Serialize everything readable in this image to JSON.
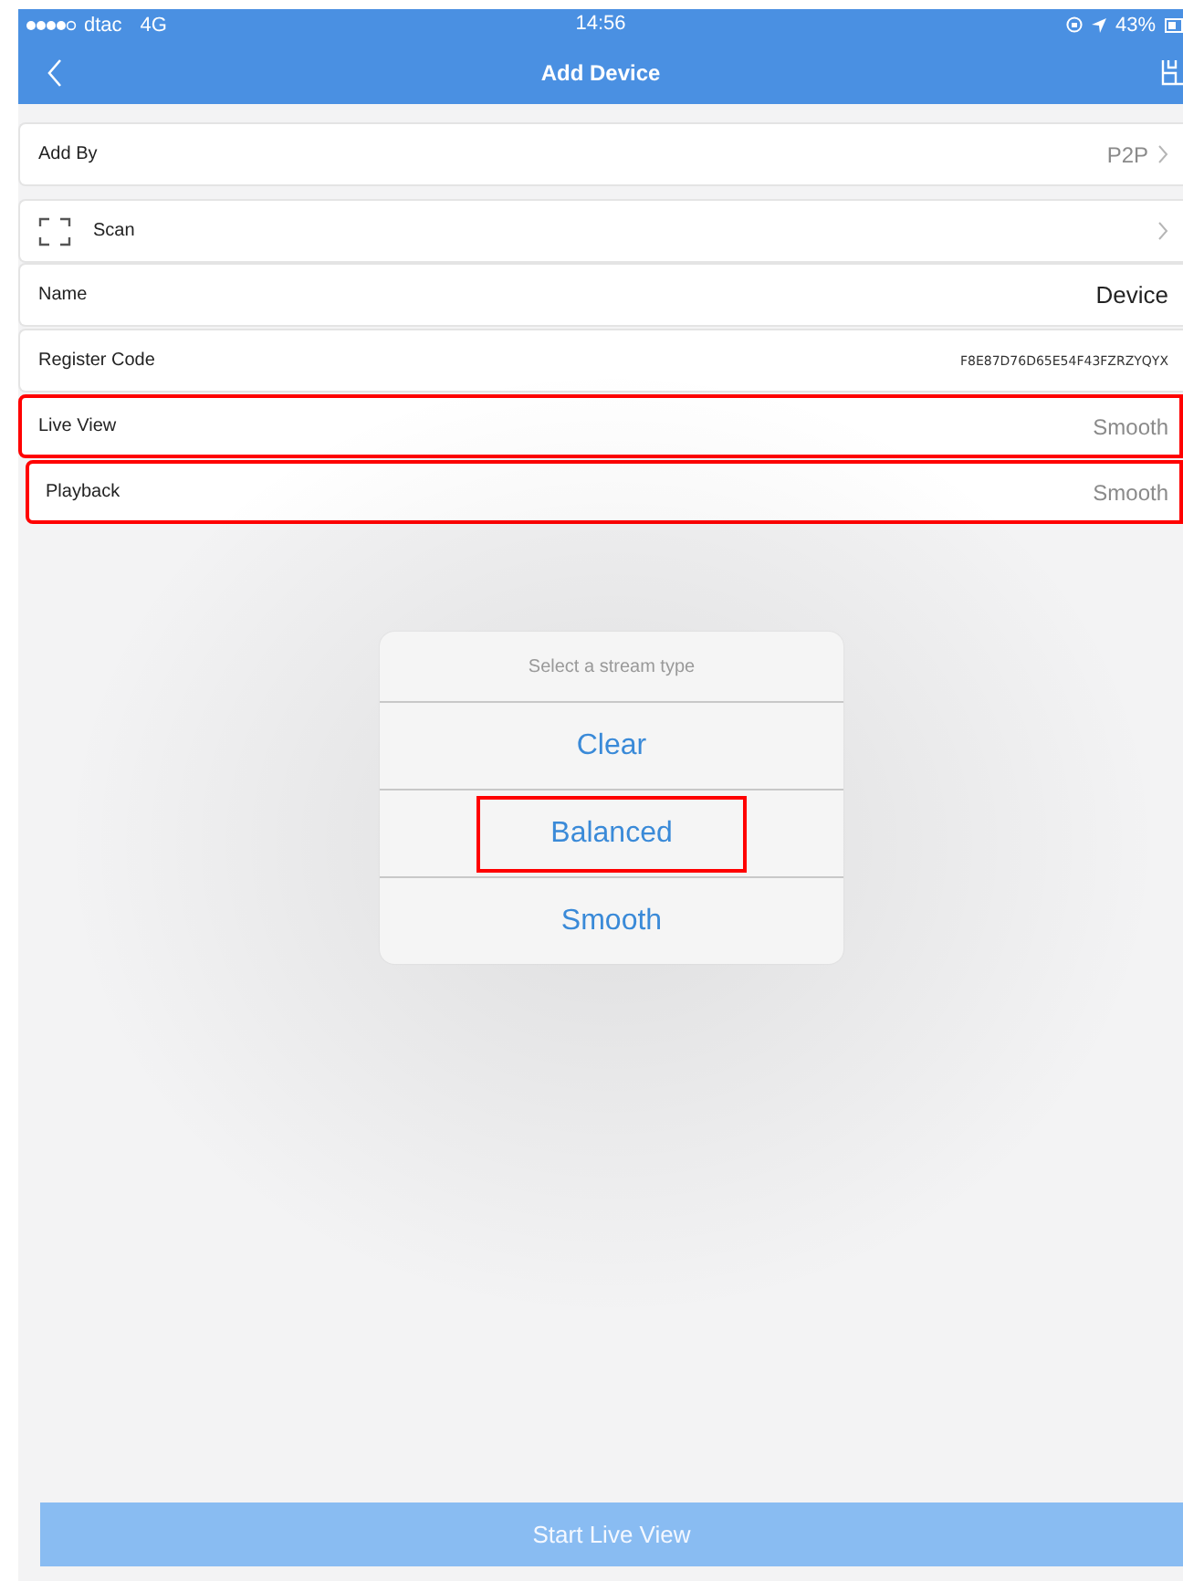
{
  "status_bar": {
    "carrier": "dtac",
    "network": "4G",
    "time": "14:56",
    "battery": "43%"
  },
  "nav": {
    "title": "Add Device"
  },
  "rows": [
    {
      "kind": "select",
      "label": "Add By",
      "value": "P2P",
      "highlighted": false
    },
    {
      "kind": "action",
      "label": "Scan",
      "highlighted": false
    },
    {
      "kind": "text",
      "label": "Name",
      "value": "Device",
      "highlighted": false
    },
    {
      "kind": "code",
      "label": "Register Code",
      "value": "F8E87D76D65E54F43FZRZYQYX",
      "highlighted": false
    },
    {
      "kind": "option",
      "label": "Live View",
      "value": "Smooth",
      "highlighted": true
    },
    {
      "kind": "option",
      "label": "Playback",
      "value": "Smooth",
      "highlighted": true
    }
  ],
  "dialog": {
    "title": "Select a stream type",
    "options": [
      {
        "label": "Clear",
        "highlighted": false
      },
      {
        "label": "Balanced",
        "highlighted": true
      },
      {
        "label": "Smooth",
        "highlighted": false
      }
    ]
  },
  "primary_button": {
    "label": "Start Live View"
  }
}
